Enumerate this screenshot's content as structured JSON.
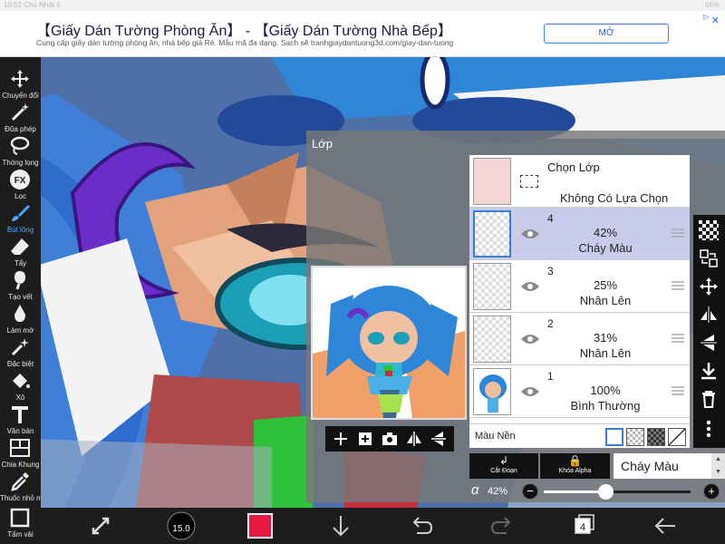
{
  "status_bar": {
    "time": "10:52  Chủ Nhật 6",
    "battery": "66%"
  },
  "ad": {
    "title": "【Giấy Dán Tường Phòng Ăn】 - 【Giấy Dán Tường Nhà Bếp】",
    "subtitle": "Cung cấp giấy dán tường phòng ăn, nhà bếp giá Rẻ. Mẫu mã đa dạng. Sạch sẽ tranhgiaydantuong3d.com/giay-dan-tuong",
    "button": "MỞ",
    "close": "✕"
  },
  "tools": [
    {
      "label": "Chuyển đổi",
      "icon": "move-icon"
    },
    {
      "label": "Đũa phép",
      "icon": "magic-wand-icon"
    },
    {
      "label": "Thòng lọng",
      "icon": "lasso-icon"
    },
    {
      "label": "Lọc",
      "icon": "fx-icon"
    },
    {
      "label": "Bút lông",
      "icon": "brush-icon",
      "active": true
    },
    {
      "label": "Tẩy",
      "icon": "eraser-icon"
    },
    {
      "label": "Tạo vết",
      "icon": "smudge-icon"
    },
    {
      "label": "Làm mờ",
      "icon": "blur-drop-icon"
    },
    {
      "label": "Đặc biệt",
      "icon": "sparkle-icon"
    },
    {
      "label": "Xô",
      "icon": "bucket-icon"
    },
    {
      "label": "Văn bản",
      "icon": "text-icon"
    },
    {
      "label": "Chia Khung",
      "icon": "frame-divider-icon"
    },
    {
      "label": "Thuốc nhỏ mắt",
      "icon": "eyedropper-icon"
    },
    {
      "label": "Tấm vải",
      "icon": "canvas-icon"
    }
  ],
  "layer_panel": {
    "title": "Lớp",
    "selection": {
      "title": "Chọn Lớp",
      "value": "Không Có Lựa Chọn"
    },
    "layers": [
      {
        "number": "4",
        "opacity": "42%",
        "blend": "Cháy Màu",
        "selected": true
      },
      {
        "number": "3",
        "opacity": "25%",
        "blend": "Nhân Lên",
        "selected": false
      },
      {
        "number": "2",
        "opacity": "31%",
        "blend": "Nhân Lên",
        "selected": false
      },
      {
        "number": "1",
        "opacity": "100%",
        "blend": "Bình Thường",
        "selected": false
      }
    ],
    "background_label": "Màu Nền",
    "clip_label": "Cắt Đoạn",
    "alpha_lock_label": "Khóa Alpha",
    "blend_mode": "Cháy Màu",
    "alpha_symbol": "α",
    "alpha_value": "42%",
    "alpha_fraction": 0.42
  },
  "bottom_bar": {
    "brush_size": "15.0",
    "primary_color": "#e8173f",
    "layer_count": "4"
  },
  "colors": {
    "toolbar_bg": "#1d1d1d",
    "active_tool": "#4fa6ff",
    "selected_layer": "#c9cbea"
  }
}
